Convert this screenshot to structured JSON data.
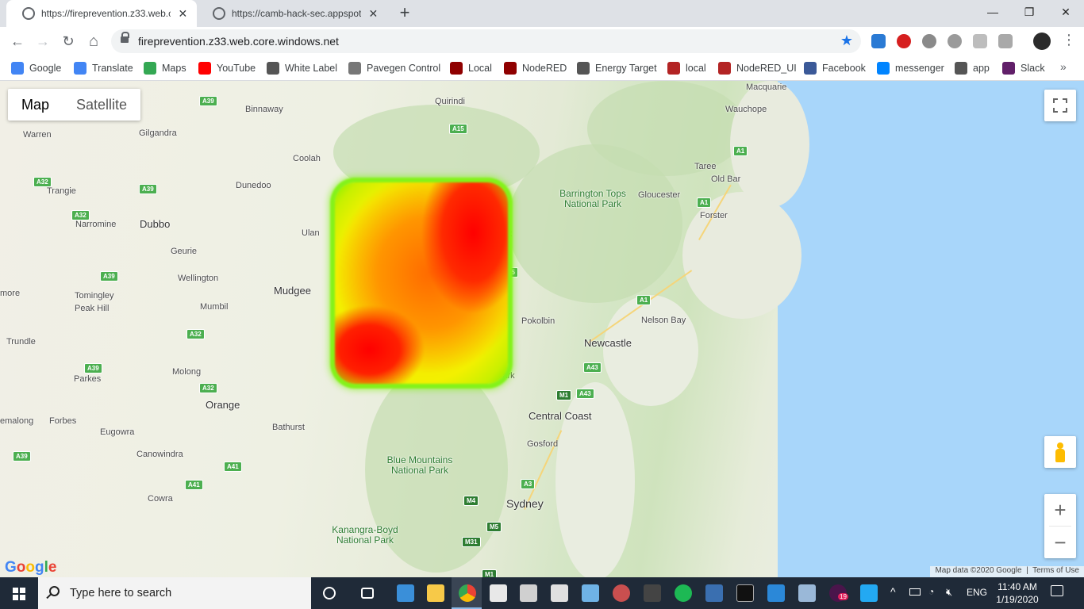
{
  "browser": {
    "tabs": [
      {
        "title": "https://fireprevention.z33.web.co",
        "close": "✕"
      },
      {
        "title": "https://camb-hack-sec.appspot.c",
        "close": "✕"
      }
    ],
    "new_tab": "+",
    "window_controls": {
      "minimize": "—",
      "maximize": "❐",
      "close": "✕"
    },
    "url": "fireprevention.z33.web.core.windows.net",
    "nav": {
      "back": "←",
      "forward": "→",
      "reload": "↻",
      "home": "⌂"
    },
    "bookmarks": [
      {
        "label": "Google",
        "color": "#4285f4"
      },
      {
        "label": "Translate",
        "color": "#4285f4"
      },
      {
        "label": "Maps",
        "color": "#34a853"
      },
      {
        "label": "YouTube",
        "color": "#ff0000"
      },
      {
        "label": "White Label",
        "color": "#555555"
      },
      {
        "label": "Pavegen Control",
        "color": "#777777"
      },
      {
        "label": "Local",
        "color": "#8f0000"
      },
      {
        "label": "NodeRED",
        "color": "#8f0000"
      },
      {
        "label": "Energy Target",
        "color": "#555555"
      },
      {
        "label": "local",
        "color": "#b32424"
      },
      {
        "label": "NodeRED_UI",
        "color": "#b32424"
      },
      {
        "label": "Facebook",
        "color": "#3b5998"
      },
      {
        "label": "messenger",
        "color": "#0084ff"
      },
      {
        "label": "app",
        "color": "#555555"
      },
      {
        "label": "Slack",
        "color": "#611f69"
      }
    ],
    "bookmarks_more": "»"
  },
  "map": {
    "type_control": {
      "map": "Map",
      "satellite": "Satellite",
      "selected": "Map"
    },
    "zoom_in": "+",
    "zoom_out": "−",
    "logo": "Google",
    "attribution": "Map data ©2020 Google",
    "terms": "Terms of Use",
    "heatmap_colors": {
      "high": "#ff0000",
      "mid": "#ffa500",
      "low": "#ffff00",
      "edge": "#84f21a"
    },
    "places": [
      "Macquarie",
      "Wauchope",
      "Taree",
      "Old Bar",
      "Forster",
      "Gloucester",
      "Binnaway",
      "Quirindi",
      "Warren",
      "Gilgandra",
      "Coolah",
      "Dunedoo",
      "Trangie",
      "Narromine",
      "Dubbo",
      "Ulan",
      "Geurie",
      "Wellington",
      "Mudgee",
      "more",
      "Tomingley",
      "Peak Hill",
      "Mumbil",
      "Trundle",
      "Molong",
      "Parkes",
      "Orange",
      "Bathurst",
      "emalong",
      "Forbes",
      "Eugowra",
      "Canowindra",
      "Cowra",
      "Pokolbin",
      "Nelson Bay",
      "Newcastle",
      "Central Coast",
      "Gosford",
      "Sydney",
      "k",
      "Park"
    ],
    "parks": [
      "Barrington Tops National Park",
      "Blue Mountains National Park",
      "Kanangra-Boyd National Park"
    ],
    "road_shields": [
      "A39",
      "A32",
      "A39",
      "A32",
      "A39",
      "A32",
      "A39",
      "A32",
      "A39",
      "A41",
      "A41",
      "A15",
      "A1",
      "A1",
      "A1",
      "15",
      "A43",
      "A43",
      "M1",
      "A3",
      "M4",
      "M5",
      "M31",
      "M1"
    ]
  },
  "taskbar": {
    "search_placeholder": "Type here to search",
    "tray_lang": "ENG",
    "time": "11:40 AM",
    "date": "1/19/2020",
    "badge": "19"
  }
}
